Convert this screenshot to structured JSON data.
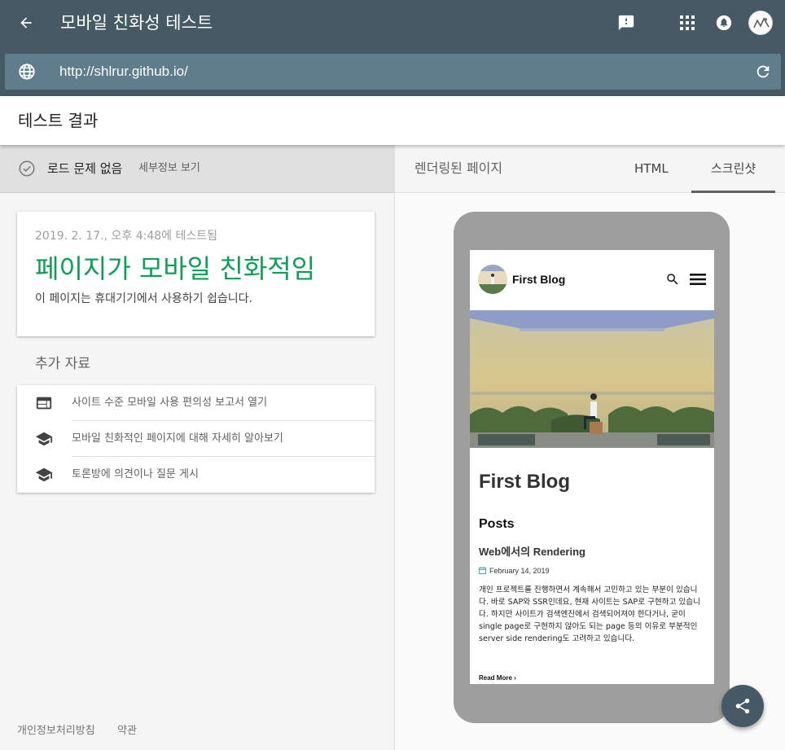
{
  "header": {
    "title": "모바일 친화성 테스트",
    "icons": [
      "arrow-back-icon",
      "feedback-icon",
      "apps-grid-icon",
      "notifications-icon",
      "account-avatar"
    ]
  },
  "url_bar": {
    "value": "http://shlrur.github.io/"
  },
  "results": {
    "title": "테스트 결과"
  },
  "status": {
    "text": "로드 문제 없음",
    "details_link": "세부정보 보기"
  },
  "result_card": {
    "tested_at": "2019. 2. 17., 오후 4:48에 테스트됨",
    "verdict": "페이지가 모바일 친화적임",
    "description": "이 페이지는 휴대기기에서 사용하기 쉽습니다."
  },
  "additional_resources": {
    "title": "추가 자료",
    "items": [
      {
        "label": "사이트 수준 모바일 사용 편의성 보고서 열기",
        "icon": "web-report-icon"
      },
      {
        "label": "모바일 친화적인 페이지에 대해 자세히 알아보기",
        "icon": "school-icon"
      },
      {
        "label": "토론방에 의견이나 질문 게시",
        "icon": "school-icon"
      }
    ]
  },
  "footer": {
    "privacy": "개인정보처리방침",
    "terms": "약관"
  },
  "right_panel": {
    "rendered_label": "렌더링된 페이지",
    "tabs": [
      "HTML",
      "스크린샷"
    ],
    "active_tab": "스크린샷"
  },
  "preview": {
    "blog_name": "First Blog",
    "blog_title": "First Blog",
    "posts_heading": "Posts",
    "post": {
      "title": "Web에서의 Rendering",
      "date": "February 14, 2019",
      "excerpt": "개인 프로젝트를 진행하면서 계속해서 고민하고 있는 부분이 있습니다. 바로 SAP와 SSR인데요, 현재 사이트는 SAP로 구현하고 있습니다. 하지만 사이트가 검색엔진에서 검색되어져야 한다거나, 굳이 single page로 구현하지 않아도 되는 page 등의 이유로 부분적인 server side rendering도 고려하고 있습니다.",
      "read_more": "Read More"
    }
  },
  "colors": {
    "header_bg": "#455a64",
    "url_bar_bg": "#607d8b",
    "success_green": "#0f9d58",
    "phone_frame": "#9e9e9e",
    "fab_bg": "#455a64"
  }
}
